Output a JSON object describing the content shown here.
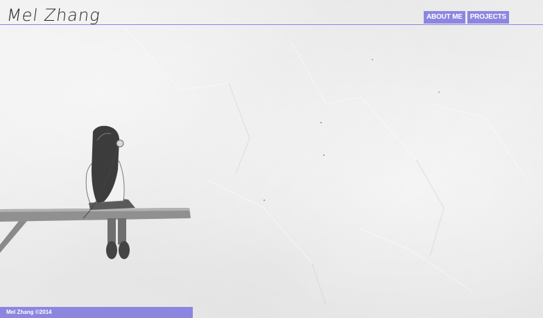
{
  "header": {
    "logo": "Mel Zhang"
  },
  "nav": {
    "items": [
      {
        "label": "ABOUT ME"
      },
      {
        "label": "PROJECTS"
      }
    ]
  },
  "footer": {
    "text": "Mel Zhang ©2014"
  },
  "colors": {
    "accent": "#8c86e0",
    "background": "#ebebeb"
  }
}
